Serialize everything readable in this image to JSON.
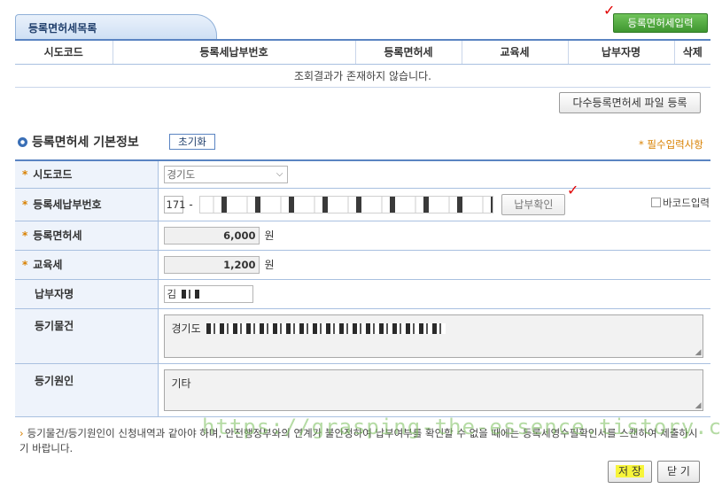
{
  "list": {
    "tab_title": "등록면허세목록",
    "register_button": "등록면허세입력",
    "columns": [
      "시도코드",
      "등록세납부번호",
      "등록면허세",
      "교육세",
      "납부자명",
      "삭제"
    ],
    "empty_message": "조회결과가 존재하지 않습니다.",
    "bulk_button": "다수등록면허세 파일 등록"
  },
  "annotations": {
    "check_mark": "✓"
  },
  "basic_info": {
    "title": "등록면허세 기본정보",
    "reset_button": "초기화",
    "required_note": "* 필수입력사항",
    "required_star": "*",
    "fields": {
      "sido_code": {
        "label": "시도코드",
        "value": "경기도"
      },
      "payment_no": {
        "label": "등록세납부번호",
        "prefix": "171",
        "dash": "-",
        "verify_button": "납부확인",
        "barcode_label": "바코드입력"
      },
      "registration_tax": {
        "label": "등록면허세",
        "value": "6,000",
        "unit": "원"
      },
      "education_tax": {
        "label": "교육세",
        "value": "1,200",
        "unit": "원"
      },
      "payer_name": {
        "label": "납부자명",
        "value": "김"
      },
      "registered_property": {
        "label": "등기물건",
        "value": "경기도"
      },
      "registration_cause": {
        "label": "등기원인",
        "value": "기타"
      }
    }
  },
  "notice": "등기물건/등기원인이 신청내역과 같아야 하며, 안전행정부와의 연계가 불안정하여 납부여부를 확인할 수 없을 때에는 등록세영수필확인서를 스캔하여 제출하시기 바랍니다.",
  "watermark": "https://grasping-the-essence.tistory.com",
  "actions": {
    "save": "저 장",
    "close": "닫 기"
  },
  "colors": {
    "accent": "#5a84c2",
    "register_green": "#3f9630",
    "required": "#d98100",
    "highlight": "#f7f53a"
  }
}
